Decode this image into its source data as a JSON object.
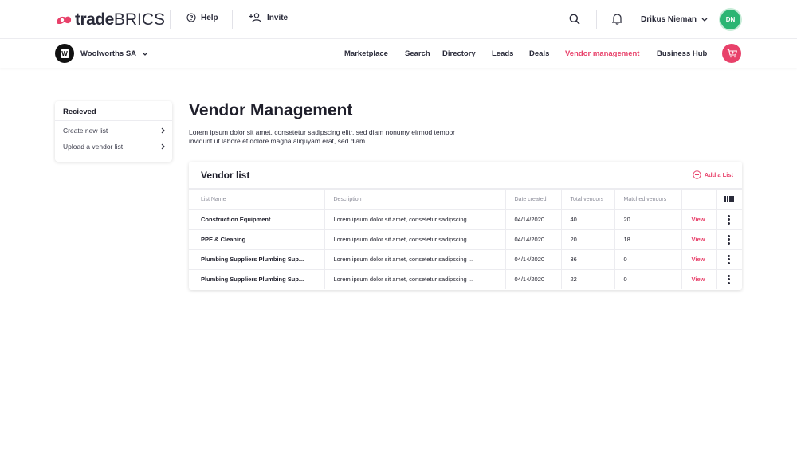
{
  "header": {
    "logo_bold": "trade",
    "logo_light": "BRICS",
    "help_label": "Help",
    "invite_label": "Invite",
    "user_name": "Drikus Nieman",
    "avatar_initials": "DN"
  },
  "navbar": {
    "org_name": "Woolworths SA",
    "org_logo": "W",
    "items": [
      {
        "label": "Marketplace"
      },
      {
        "label": "Search"
      },
      {
        "label": "Directory"
      },
      {
        "label": "Leads"
      },
      {
        "label": "Deals"
      },
      {
        "label": "Vendor management",
        "active": true
      },
      {
        "label": "Business Hub"
      }
    ]
  },
  "sidebar": {
    "title": "Recieved",
    "items": [
      {
        "label": "Create new list"
      },
      {
        "label": "Upload a vendor list"
      }
    ]
  },
  "main": {
    "title": "Vendor Management",
    "description": "Lorem ipsum dolor sit amet, consetetur sadipscing elitr, sed diam nonumy eirmod tempor invidunt ut labore et dolore magna aliquyam erat, sed diam."
  },
  "vendor_table": {
    "title": "Vendor list",
    "add_label": "Add a List",
    "columns": [
      "List Name",
      "Description",
      "Date created",
      "Total vendors",
      "Matched vendors"
    ],
    "rows": [
      {
        "name": "Construction Equipment",
        "description": "Lorem ipsum dolor sit amet, consetetur sadipscing ...",
        "date": "04/14/2020",
        "total": "40",
        "matched": "20",
        "action": "View"
      },
      {
        "name": "PPE & Cleaning",
        "description": "Lorem ipsum dolor sit amet, consetetur sadipscing ...",
        "date": "04/14/2020",
        "total": "20",
        "matched": "18",
        "action": "View"
      },
      {
        "name": "Plumbing Suppliers Plumbing Sup...",
        "description": "Lorem ipsum dolor sit amet, consetetur sadipscing ...",
        "date": "04/14/2020",
        "total": "36",
        "matched": "0",
        "action": "View"
      },
      {
        "name": "Plumbing Suppliers Plumbing Sup...",
        "description": "Lorem ipsum dolor sit amet, consetetur sadipscing ...",
        "date": "04/14/2020",
        "total": "22",
        "matched": "0",
        "action": "View"
      }
    ]
  },
  "colors": {
    "accent": "#e8416a",
    "avatar": "#2bb573",
    "text": "#1f1f2b"
  },
  "icons": [
    "help-icon",
    "add-user-icon",
    "search-icon",
    "bell-icon",
    "chevron-down-icon",
    "chevron-right-icon",
    "cart-icon",
    "plus-circle-icon",
    "columns-icon",
    "kebab-menu-icon"
  ]
}
